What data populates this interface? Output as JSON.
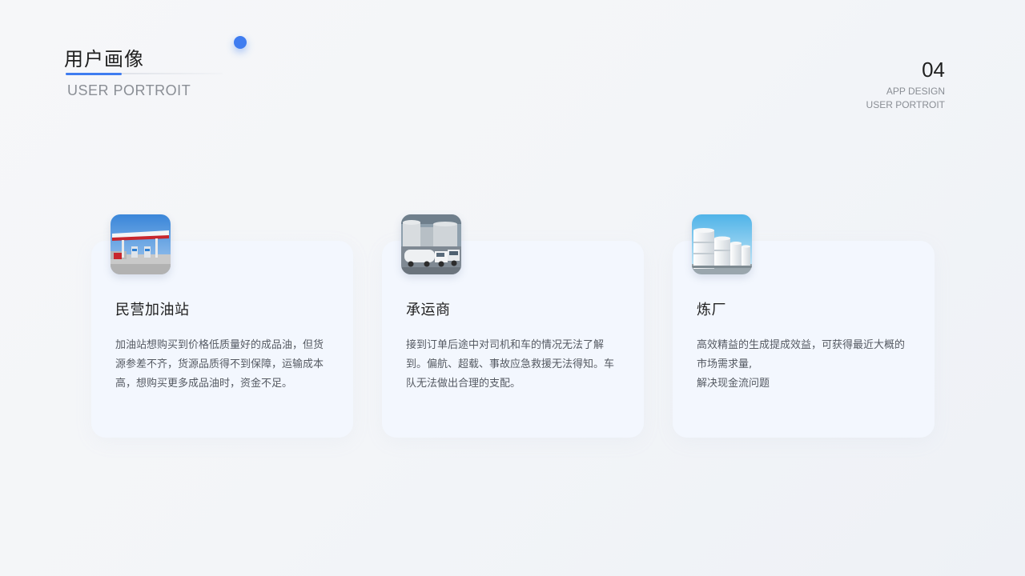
{
  "header": {
    "title": "用户画像",
    "subtitle": "USER PORTROIT",
    "page_number": "04",
    "meta_line1": "APP DESIGN",
    "meta_line2": "USER PORTROIT"
  },
  "colors": {
    "accent": "#3f7cf0",
    "card_bg": "#f3f7fe"
  },
  "cards": [
    {
      "icon": "gas-station-photo",
      "title": "民营加油站",
      "description": "加油站想购买到价格低质量好的成品油，但货源参差不齐，货源品质得不到保障，运输成本高，想购买更多成品油时，资金不足。"
    },
    {
      "icon": "tanker-truck-photo",
      "title": "承运商",
      "description": "接到订单后途中对司机和车的情况无法了解到。偏航、超载、事故应急救援无法得知。车队无法做出合理的支配。"
    },
    {
      "icon": "refinery-tanks-photo",
      "title": "炼厂",
      "description": "高效精益的生成提成效益，可获得最近大概的市场需求量,\n解决现金流问题"
    }
  ]
}
